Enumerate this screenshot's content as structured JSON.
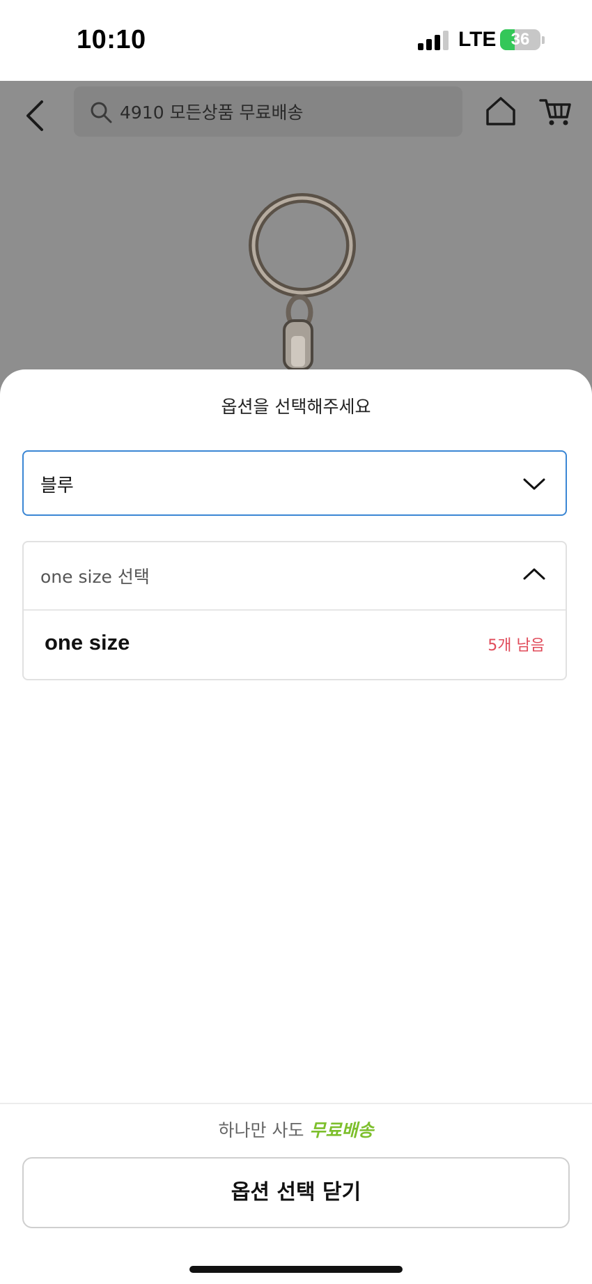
{
  "status_bar": {
    "time": "10:10",
    "network": "LTE",
    "battery_level": "36",
    "battery_fraction": 0.36,
    "signal_bars_active": 3,
    "signal_bars_total": 4,
    "battery_color": "#34c759"
  },
  "header": {
    "search_text": "4910 모든상품 무료배송",
    "icons": [
      "back-arrow-icon",
      "search-icon",
      "home-icon",
      "cart-icon"
    ]
  },
  "sheet": {
    "title": "옵션을 선택해주세요",
    "color_select": {
      "value": "블루",
      "border_color": "#3a86d4"
    },
    "size_select": {
      "header_label": "one size 선택",
      "options": [
        {
          "name": "one size",
          "stock": "5개 남음"
        }
      ],
      "stock_color": "#e04b5a"
    }
  },
  "footer": {
    "promo_prefix": "하나만 사도",
    "promo_free": "무료배송",
    "promo_free_color": "#7dbf2c",
    "close_label": "옵션 선택 닫기"
  }
}
